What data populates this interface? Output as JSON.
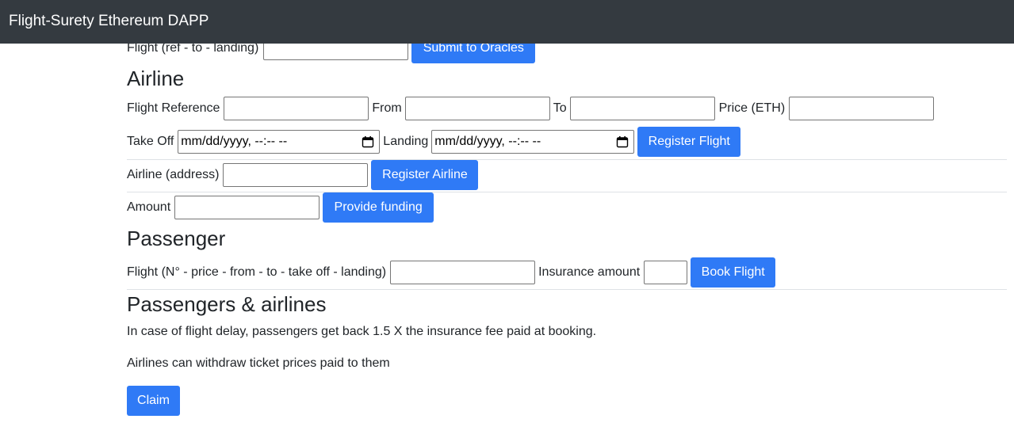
{
  "navbar": {
    "brand": "Flight-Surety Ethereum DAPP"
  },
  "oracles": {
    "flight_label": "Flight (ref - to - landing)",
    "flight_value": "",
    "submit_button": "Submit to Oracles"
  },
  "airline": {
    "title": "Airline",
    "flight_reference_label": "Flight Reference",
    "from_label": "From",
    "to_label": "To",
    "price_label": "Price (ETH)",
    "take_off_label": "Take Off",
    "take_off_value": "mm/dd/yyyy, --:-- --",
    "landing_label": "Landing",
    "landing_value": "mm/dd/yyyy, --:-- --",
    "register_flight_button": "Register Flight",
    "address_label": "Airline (address)",
    "register_airline_button": "Register Airline",
    "amount_label": "Amount",
    "provide_funding_button": "Provide funding"
  },
  "passenger": {
    "title": "Passenger",
    "flight_label": "Flight (N° - price - from - to - take off - landing)",
    "insurance_label": "Insurance amount",
    "book_flight_button": "Book Flight"
  },
  "common": {
    "title": "Passengers & airlines",
    "text_delay": "In case of flight delay, passengers get back 1.5 X the insurance fee paid at booking.",
    "text_withdraw": "Airlines can withdraw ticket prices paid to them",
    "claim_button": "Claim"
  },
  "colors": {
    "navbar_bg": "#343a40",
    "primary_button": "#2f7af6"
  }
}
